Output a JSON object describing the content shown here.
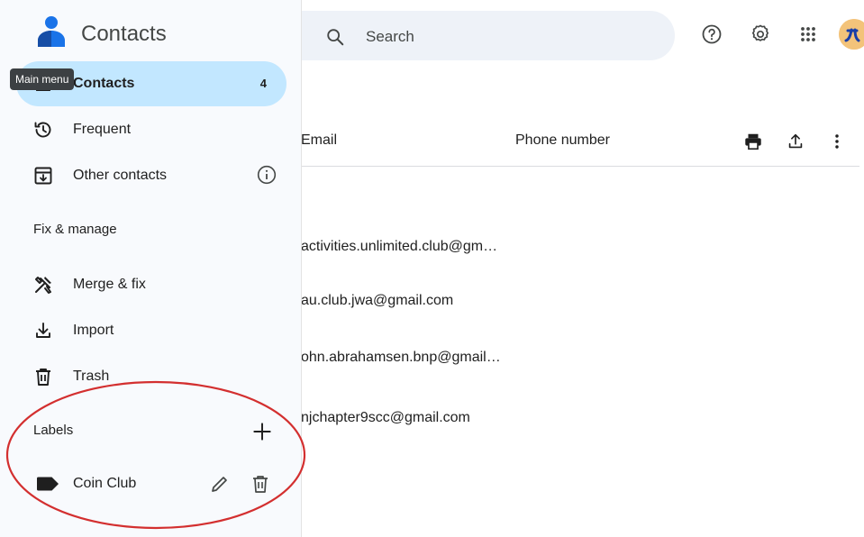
{
  "app": {
    "title": "Contacts"
  },
  "tooltip": "Main menu",
  "sidebar": {
    "items": [
      {
        "label": "Contacts",
        "count": "4"
      },
      {
        "label": "Frequent"
      },
      {
        "label": "Other contacts"
      }
    ],
    "fix_manage": {
      "heading": "Fix & manage",
      "items": [
        {
          "label": "Merge & fix"
        },
        {
          "label": "Import"
        },
        {
          "label": "Trash"
        }
      ]
    },
    "labels": {
      "heading": "Labels",
      "items": [
        {
          "label": "Coin Club"
        }
      ]
    }
  },
  "search": {
    "placeholder": "Search"
  },
  "table": {
    "columns": {
      "email": "Email",
      "phone": "Phone number"
    },
    "rows": [
      {
        "email": "activities.unlimited.club@gm…",
        "phone": ""
      },
      {
        "email": "au.club.jwa@gmail.com",
        "phone": ""
      },
      {
        "email": "ohn.abrahamsen.bnp@gmail…",
        "phone": ""
      },
      {
        "email": "njchapter9scc@gmail.com",
        "phone": ""
      }
    ]
  },
  "icons": {
    "topbar": [
      "help-icon",
      "settings-icon",
      "apps-icon"
    ],
    "header_actions": [
      "print-icon",
      "export-icon",
      "more-vert-icon"
    ]
  },
  "colors": {
    "active_nav": "#c2e7ff",
    "annotation": "#d32f2f",
    "brand": "#1a73e8"
  }
}
